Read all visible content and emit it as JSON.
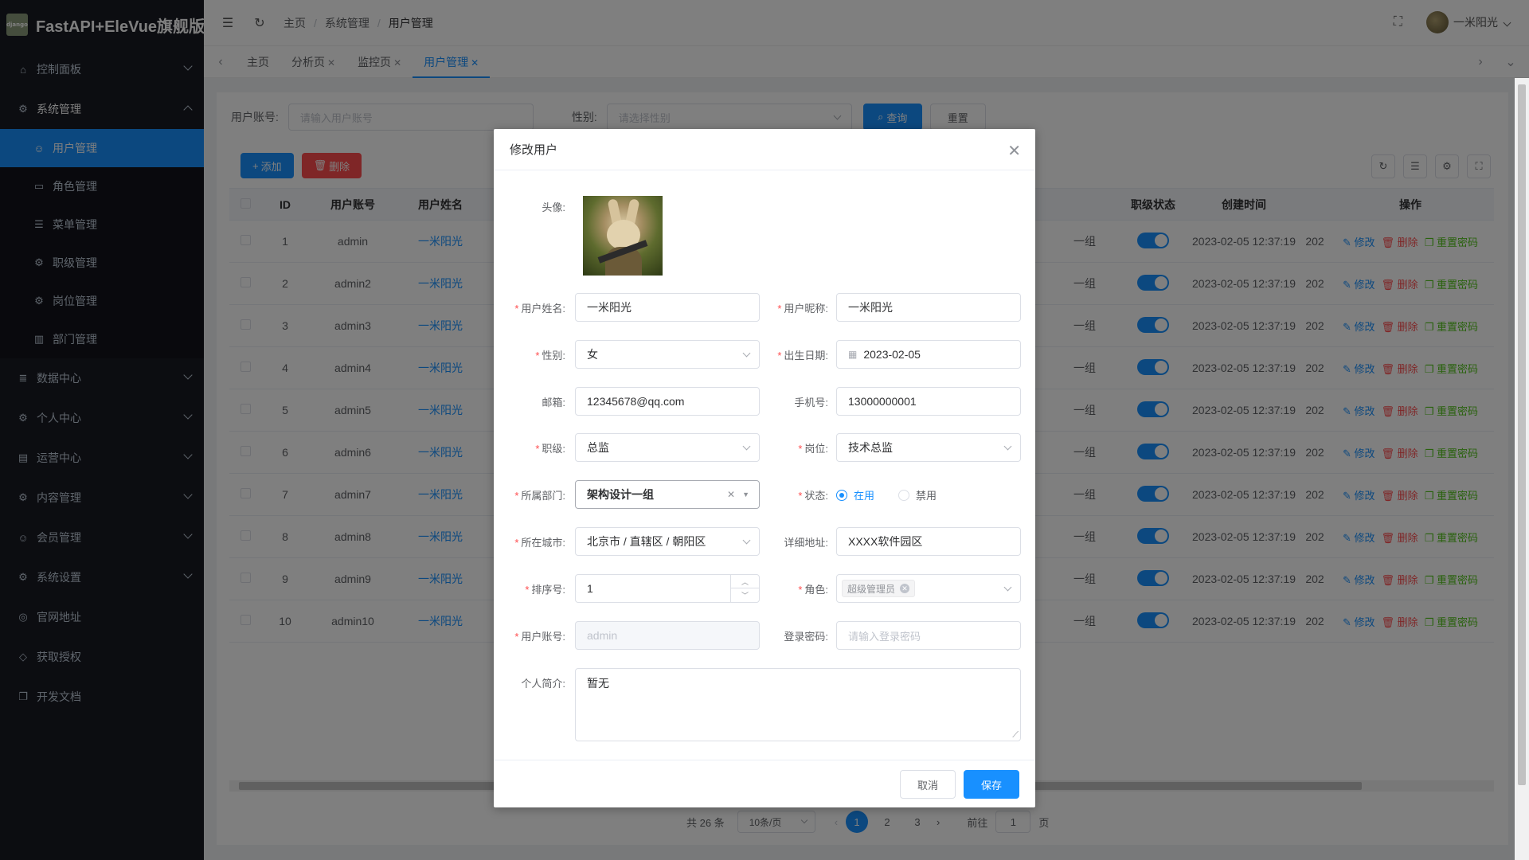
{
  "app": {
    "title": "FastAPI+EleVue旗舰版",
    "logo_text": "django"
  },
  "sidebar": {
    "items": [
      {
        "label": "控制面板",
        "icon": "home-icon",
        "expanded": false
      },
      {
        "label": "系统管理",
        "icon": "gear-icon",
        "expanded": true
      },
      {
        "label": "数据中心",
        "icon": "database-icon",
        "expanded": false
      },
      {
        "label": "个人中心",
        "icon": "cogs-icon",
        "expanded": false
      },
      {
        "label": "运营中心",
        "icon": "card-icon",
        "expanded": false
      },
      {
        "label": "内容管理",
        "icon": "cogs-icon",
        "expanded": false
      },
      {
        "label": "会员管理",
        "icon": "user-icon",
        "expanded": false
      },
      {
        "label": "系统设置",
        "icon": "cogs-icon",
        "expanded": false
      },
      {
        "label": "官网地址",
        "icon": "globe-icon"
      },
      {
        "label": "获取授权",
        "icon": "diamond-icon"
      },
      {
        "label": "开发文档",
        "icon": "copy-icon"
      }
    ],
    "sub_items": [
      {
        "label": "用户管理",
        "icon": "user-icon",
        "active": true
      },
      {
        "label": "角色管理",
        "icon": "id-card-icon"
      },
      {
        "label": "菜单管理",
        "icon": "sliders-icon"
      },
      {
        "label": "职级管理",
        "icon": "gear-icon"
      },
      {
        "label": "岗位管理",
        "icon": "gear-icon"
      },
      {
        "label": "部门管理",
        "icon": "building-icon"
      }
    ]
  },
  "header": {
    "breadcrumb": [
      "主页",
      "系统管理",
      "用户管理"
    ],
    "user_name": "一米阳光"
  },
  "tabs": [
    {
      "label": "主页",
      "closable": false
    },
    {
      "label": "分析页",
      "closable": true
    },
    {
      "label": "监控页",
      "closable": true
    },
    {
      "label": "用户管理",
      "closable": true,
      "active": true
    }
  ],
  "search": {
    "account_label": "用户账号:",
    "account_placeholder": "请输入用户账号",
    "gender_label": "性别:",
    "gender_placeholder": "请选择性别",
    "query_label": "查询",
    "reset_label": "重置"
  },
  "toolbar": {
    "add_label": "添加",
    "delete_label": "删除"
  },
  "table": {
    "headers": {
      "id": "ID",
      "account": "用户账号",
      "name": "用户姓名",
      "status": "职级状态",
      "created": "创建时间",
      "ops": "操作"
    },
    "dept_partial": "一组",
    "partial_date": "202",
    "ops": {
      "edit": "修改",
      "delete": "删除",
      "reset": "重置密码"
    },
    "rows": [
      {
        "id": "1",
        "account": "admin",
        "name": "一米阳光",
        "created": "2023-02-05 12:37:19"
      },
      {
        "id": "2",
        "account": "admin2",
        "name": "一米阳光",
        "created": "2023-02-05 12:37:19"
      },
      {
        "id": "3",
        "account": "admin3",
        "name": "一米阳光",
        "created": "2023-02-05 12:37:19"
      },
      {
        "id": "4",
        "account": "admin4",
        "name": "一米阳光",
        "created": "2023-02-05 12:37:19"
      },
      {
        "id": "5",
        "account": "admin5",
        "name": "一米阳光",
        "created": "2023-02-05 12:37:19"
      },
      {
        "id": "6",
        "account": "admin6",
        "name": "一米阳光",
        "created": "2023-02-05 12:37:19"
      },
      {
        "id": "7",
        "account": "admin7",
        "name": "一米阳光",
        "created": "2023-02-05 12:37:19"
      },
      {
        "id": "8",
        "account": "admin8",
        "name": "一米阳光",
        "created": "2023-02-05 12:37:19"
      },
      {
        "id": "9",
        "account": "admin9",
        "name": "一米阳光",
        "created": "2023-02-05 12:37:19"
      },
      {
        "id": "10",
        "account": "admin10",
        "name": "一米阳光",
        "created": "2023-02-05 12:37:19"
      }
    ]
  },
  "pagination": {
    "total": "共 26 条",
    "page_size": "10条/页",
    "pages": [
      "1",
      "2",
      "3"
    ],
    "goto_label": "前往",
    "goto_value": "1",
    "page_unit": "页"
  },
  "dialog": {
    "title": "修改用户",
    "avatar_label": "头像:",
    "fields": {
      "realname": {
        "label": "用户姓名:",
        "value": "一米阳光"
      },
      "nickname": {
        "label": "用户昵称:",
        "value": "一米阳光"
      },
      "gender": {
        "label": "性别:",
        "value": "女"
      },
      "birthday": {
        "label": "出生日期:",
        "value": "2023-02-05"
      },
      "email": {
        "label": "邮箱:",
        "value": "12345678@qq.com"
      },
      "mobile": {
        "label": "手机号:",
        "value": "13000000001"
      },
      "level": {
        "label": "职级:",
        "value": "总监"
      },
      "position": {
        "label": "岗位:",
        "value": "技术总监"
      },
      "dept": {
        "label": "所属部门:",
        "value": "架构设计一组"
      },
      "status": {
        "label": "状态:",
        "options": [
          "在用",
          "禁用"
        ]
      },
      "city": {
        "label": "所在城市:",
        "value": "北京市 / 直辖区 / 朝阳区"
      },
      "address": {
        "label": "详细地址:",
        "value": "XXXX软件园区"
      },
      "sort": {
        "label": "排序号:",
        "value": "1"
      },
      "role": {
        "label": "角色:",
        "value": "超级管理员"
      },
      "account": {
        "label": "用户账号:",
        "value": "admin"
      },
      "password": {
        "label": "登录密码:",
        "placeholder": "请输入登录密码"
      },
      "intro": {
        "label": "个人简介:",
        "value": "暂无"
      }
    },
    "cancel_label": "取消",
    "save_label": "保存"
  },
  "colors": {
    "primary": "#1890ff",
    "danger": "#ff4d4f",
    "success": "#52c41a",
    "sidebar": "#191a23"
  }
}
